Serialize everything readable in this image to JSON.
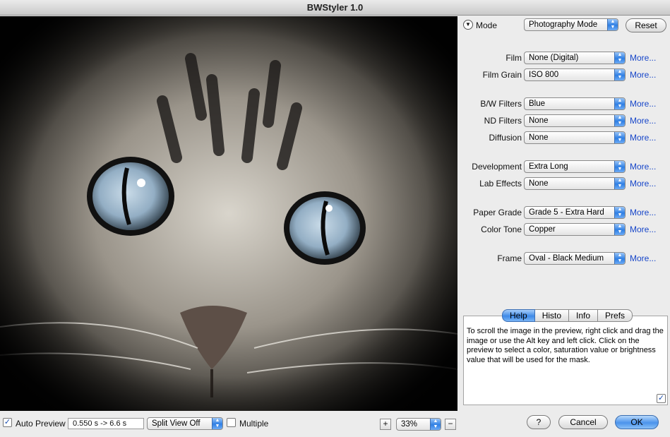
{
  "window": {
    "title": "BWStyler 1.0"
  },
  "mode": {
    "label": "Mode",
    "selected": "Photography Mode",
    "reset_label": "Reset"
  },
  "settings": [
    {
      "label": "Film",
      "value": "None (Digital)",
      "more": "More..."
    },
    {
      "label": "Film Grain",
      "value": "ISO 800",
      "more": "More..."
    },
    {
      "label": "B/W Filters",
      "value": "Blue",
      "more": "More..."
    },
    {
      "label": "ND Filters",
      "value": "None",
      "more": "More..."
    },
    {
      "label": "Diffusion",
      "value": "None",
      "more": "More..."
    },
    {
      "label": "Development",
      "value": "Extra Long",
      "more": "More..."
    },
    {
      "label": "Lab Effects",
      "value": "None",
      "more": "More..."
    },
    {
      "label": "Paper Grade",
      "value": "Grade 5 - Extra Hard",
      "more": "More..."
    },
    {
      "label": "Color Tone",
      "value": "Copper",
      "more": "More..."
    },
    {
      "label": "Frame",
      "value": "Oval - Black Medium",
      "more": "More..."
    }
  ],
  "tabs": [
    {
      "label": "Help"
    },
    {
      "label": "Histo"
    },
    {
      "label": "Info"
    },
    {
      "label": "Prefs"
    }
  ],
  "help_text": "To scroll the image in the preview, right click and drag the image or use the Alt key and left click. Click on the preview to select a color, saturation value or brightness value that will be used for the mask.",
  "bottom": {
    "auto_preview_label": "Auto Preview",
    "timing": "0.550 s -> 6.6 s",
    "split_view": "Split View Off",
    "multiple_label": "Multiple",
    "zoom_plus": "+",
    "zoom_value": "33%",
    "zoom_minus": "−",
    "help_button": "?",
    "cancel_button": "Cancel",
    "ok_button": "OK"
  },
  "colors": {
    "accent": "#3e8ae8",
    "link": "#1746c9"
  },
  "icons": {
    "disclosure": "disclosure-triangle-icon",
    "popup_arrows": "popup-arrows-icon",
    "checkmark": "checkmark-icon"
  }
}
